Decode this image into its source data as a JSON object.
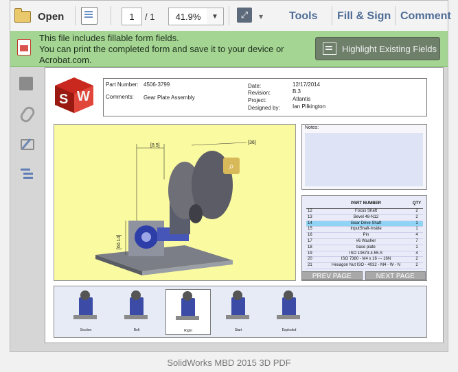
{
  "toolbar": {
    "open_label": "Open",
    "page_current": "1",
    "page_total": "/ 1",
    "zoom": "41.9%",
    "tools_label": "Tools",
    "fill_sign_label": "Fill & Sign",
    "comment_label": "Comment"
  },
  "notification": {
    "line1": "This file includes fillable form fields.",
    "line2": "You can print the completed form and save it to your device or Acrobat.com.",
    "highlight_label": "Highlight Existing Fields"
  },
  "document": {
    "part_number_label": "Part Number:",
    "part_number": "4506-3799",
    "comments_label": "Comments:",
    "comments": "Gear Plate Assembly",
    "date_label": "Date:",
    "date": "12/17/2014",
    "revision_label": "Revision:",
    "revision": "B.3",
    "project_label": "Project:",
    "project": "Atlantis",
    "designed_by_label": "Designed by:",
    "designed_by": "Ian Pilkington",
    "notes_label": "Notes:",
    "dim_1": "[8.5]",
    "dim_2": "[36]",
    "dim_3": "[60.14]",
    "bom_header": {
      "num": "",
      "part": "PART NUMBER",
      "qty": "QTY"
    },
    "bom_rows": [
      {
        "num": "12",
        "part": "Focus Shaft",
        "qty": "2"
      },
      {
        "num": "13",
        "part": "Bevel 48-N12",
        "qty": "2"
      },
      {
        "num": "14",
        "part": "Gear Drive Shaft",
        "qty": "1"
      },
      {
        "num": "15",
        "part": "InputShaft-Inside",
        "qty": "1"
      },
      {
        "num": "16",
        "part": "Pin",
        "qty": "4"
      },
      {
        "num": "17",
        "part": "#6 Washer",
        "qty": "7"
      },
      {
        "num": "18",
        "part": "base plate",
        "qty": "1"
      },
      {
        "num": "19",
        "part": "ISO 10673-4.55-S",
        "qty": "4"
      },
      {
        "num": "20",
        "part": "ISO 7380 - M4 x 16 --- 16N",
        "qty": "2"
      },
      {
        "num": "21",
        "part": "Hexagon Nut ISO - 4032 - M4 - W - N",
        "qty": "2"
      }
    ],
    "prev_label": "PREV PAGE",
    "next_label": "NEXT PAGE",
    "views": [
      "Section",
      "Bolt",
      "Right",
      "Start",
      "Exploded"
    ]
  },
  "caption": "SolidWorks MBD 2015 3D PDF",
  "colors": {
    "accent": "#4e6c96",
    "notify_bg": "#a4d592",
    "viewer_bg": "#fafaa0"
  }
}
